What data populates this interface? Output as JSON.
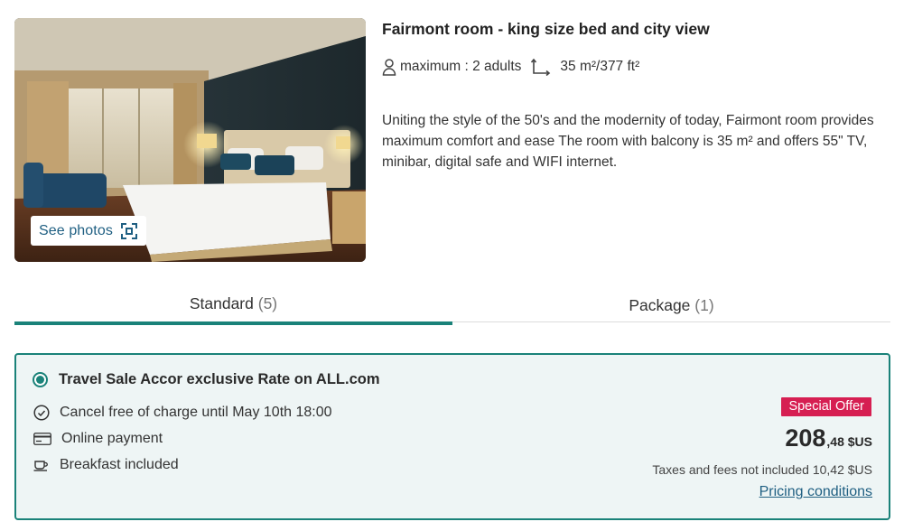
{
  "room": {
    "title": "Fairmont room - king size bed and city view",
    "see_photos_label": "See photos",
    "capacity": "maximum : 2 adults",
    "size": "35 m²/377 ft²",
    "description": "Uniting the style of the 50's and the modernity of today, Fairmont room provides maximum comfort and ease The room with balcony is 35 m² and offers 55\" TV, minibar, digital safe and WIFI internet."
  },
  "tabs": [
    {
      "label": "Standard",
      "count": "(5)",
      "active": true
    },
    {
      "label": "Package",
      "count": "(1)",
      "active": false
    }
  ],
  "rate": {
    "name": "Travel Sale Accor exclusive Rate on ALL.com",
    "selected": true,
    "perks": [
      {
        "icon": "clock-icon",
        "label": "Cancel free of charge until May 10th 18:00"
      },
      {
        "icon": "credit-card-icon",
        "label": "Online payment"
      },
      {
        "icon": "coffee-cup-icon",
        "label": "Breakfast included"
      }
    ],
    "badge": "Special Offer",
    "price_integer": "208",
    "price_decimal": ",48 $US",
    "taxes": "Taxes and fees not included 10,42 $US",
    "pricing_link": "Pricing conditions"
  },
  "colors": {
    "accent": "#1a8279",
    "badge": "#d61f52",
    "link": "#1f5f82",
    "card_bg": "#eef5f5"
  }
}
